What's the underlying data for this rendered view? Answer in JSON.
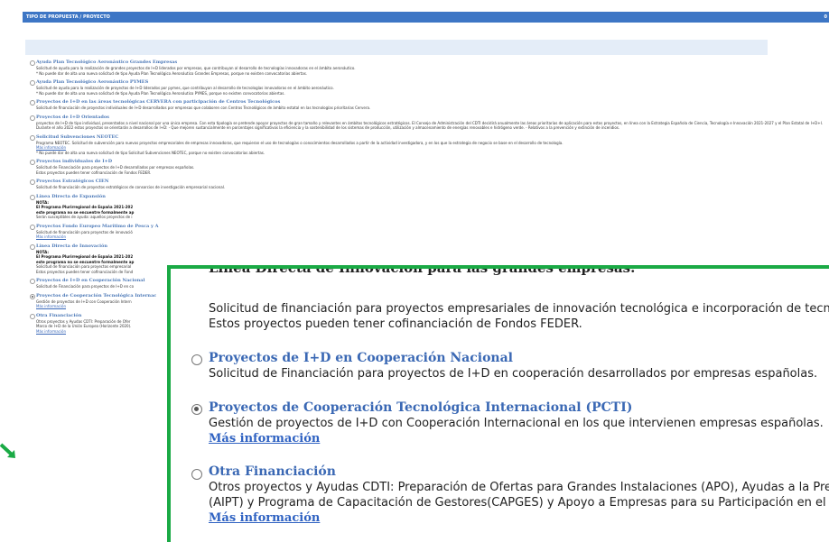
{
  "header": {
    "title": "TIPO DE PROPUESTA / PROYECTO",
    "right": "0"
  },
  "options": [
    {
      "title": "Ayuda Plan Tecnológico Aeronáutico Grandes Empresas",
      "desc": "Solicitud de ayuda para la realización de grandes proyectos de I+D liderados por empresas, que contribuyan al desarrollo de tecnologías innovadoras en el ámbito aeronáutico.",
      "note": "* No puede dar de alta una nueva solicitud de tipo Ayuda Plan Tecnológico Aeronáutico Grandes Empresas, porque no existen convocatorias abiertas."
    },
    {
      "title": "Ayuda Plan Tecnológico Aeronáutico PYMES",
      "desc": "Solicitud de ayuda para la realización de proyectos de I+D liderados por pymes, que contribuyan al desarrollo de tecnologías innovadoras en el ámbito aeronáutico.",
      "note": "* No puede dar de alta una nueva solicitud de tipo Ayuda Plan Tecnológico Aeronáutico PYMES, porque no existen convocatorias abiertas."
    },
    {
      "title": "Proyectos de I+D en las áreas tecnológicas CERVERA con participación de Centros Tecnológicos",
      "desc": "Solicitud de financiación de proyectos individuales de I+D desarrollados por empresas que colaboren con Centros Tecnológicos de ámbito estatal en las tecnologías prioritarias Cervera."
    },
    {
      "title": "Proyectos de I+D Orientados",
      "desc": "proyectos de I+D de tipo individual, presentados a nivel nacional por una única empresa. Con esta tipología se pretende apoyar proyectos de gran tamaño y relevantes en ámbitos tecnológicos estratégicos. El Consejo de Administración del CDTI decidirá anualmente las áreas prioritarias de aplicación para estos proyectos, en línea con la Estrategia Española de Ciencia, Tecnología e Innovación 2021-2027 y el Plan Estatal de I+D+I. Durante el año 2022 estos proyectos se orientarán a desarrollos de I+D: - Que mejoren sustancialmente en porcentajes significativos la eficiencia y la sostenibilidad de los sistemas de producción, utilización y almacenamiento de energías renovables e hidrógeno verde. - Relativos a la prevención y extinción de incendios."
    },
    {
      "title": "Solicitud Subvenciones NEOTEC",
      "desc": "Programa NEOTEC. Solicitud de subvención para nuevos proyectos empresariales de empresas innovadoras, que requieran el uso de tecnologías o conocimientos desarrollados a partir de la actividad investigadora, y en los que la estrategia de negocio se base en el desarrollo de tecnología.",
      "link": "Más información",
      "note": "* No puede dar de alta una nueva solicitud de tipo Solicitud Subvenciones NEOTEC, porque no existen convocatorias abiertas."
    },
    {
      "title": "Proyectos individuales de I+D",
      "desc": "Solicitud de Financiación para proyectos de I+D desarrollados por empresas españolas.",
      "desc2": "Estos proyectos pueden tener cofinanciación de Fondos FEDER."
    },
    {
      "title": "Proyectos Estratégicos CIEN",
      "desc": "Solicitud de financiación de proyectos estratégicos de consorcios de investigación empresarial nacional."
    },
    {
      "title": "Línea Directa de Expansión",
      "bold1": "NOTA:",
      "bold2": "El Programa Plurirregional de España 2021-202",
      "bold3": "este programa no se encuentre formalmente ap",
      "desc": "Serán susceptibles de ayuda: aquellos proyectos de i"
    },
    {
      "title": "Proyectos Fondo Europeo Marítimo de Pesca y A",
      "desc": "Solicitud de financiación para proyectos de innovació",
      "link": "Más información"
    },
    {
      "title": "Línea Directa de Innovación",
      "bold1": "NOTA:",
      "bold2": "El Programa Plurirregional de España 2021-202",
      "bold3": "este programa no se encuentre formalmente ap",
      "desc": "Solicitud de financiación para proyectos empresarial",
      "desc2": "Estos proyectos pueden tener cofinanciación de Fond"
    },
    {
      "title": "Proyectos de I+D en Cooperación Nacional",
      "desc": "Solicitud de Financiación para proyectos de I+D en co"
    },
    {
      "title": "Proyectos de Cooperación Tecnológica Internac",
      "desc": "Gestión de proyectos de I+D con Cooperación Intern",
      "link": "Más información",
      "selected": true
    },
    {
      "title": "Otra Financiación",
      "desc": "Otros proyectos y Ayudas CDTI: Preparación de Ofer",
      "desc2": "Marco de I+D de la Unión Europea (Horizonte 2020).",
      "link": "Más información"
    }
  ],
  "zoom": {
    "partial_title": "Línea Directa de Innovación para las grandes empresas.",
    "intro_desc1": "Solicitud de financiación para proyectos empresariales de innovación tecnológica e incorporación de tecnol",
    "intro_desc2": "Estos proyectos pueden tener cofinanciación de Fondos FEDER.",
    "opt1_title": "Proyectos de I+D en Cooperación Nacional",
    "opt1_desc": "Solicitud de Financiación para proyectos de I+D en cooperación desarrollados por empresas españolas.",
    "opt2_title": "Proyectos de Cooperación Tecnológica Internacional (PCTI)",
    "opt2_desc": "Gestión de proyectos de I+D con Cooperación Internacional en los que intervienen empresas españolas.",
    "opt2_link": "Más información",
    "opt3_title": "Otra Financiación",
    "opt3_desc1": "Otros proyectos y Ayudas CDTI: Preparación de Ofertas para Grandes Instalaciones (APO), Ayudas a la Pre",
    "opt3_desc2": "(AIPT) y Programa de Capacitación de Gestores(CAPGES) y Apoyo a Empresas para su Participación en el I",
    "opt3_link": "Más información"
  },
  "colors": {
    "header": "#3d76c5",
    "title": "#4b78b7",
    "highlight": "#1aaa45"
  }
}
